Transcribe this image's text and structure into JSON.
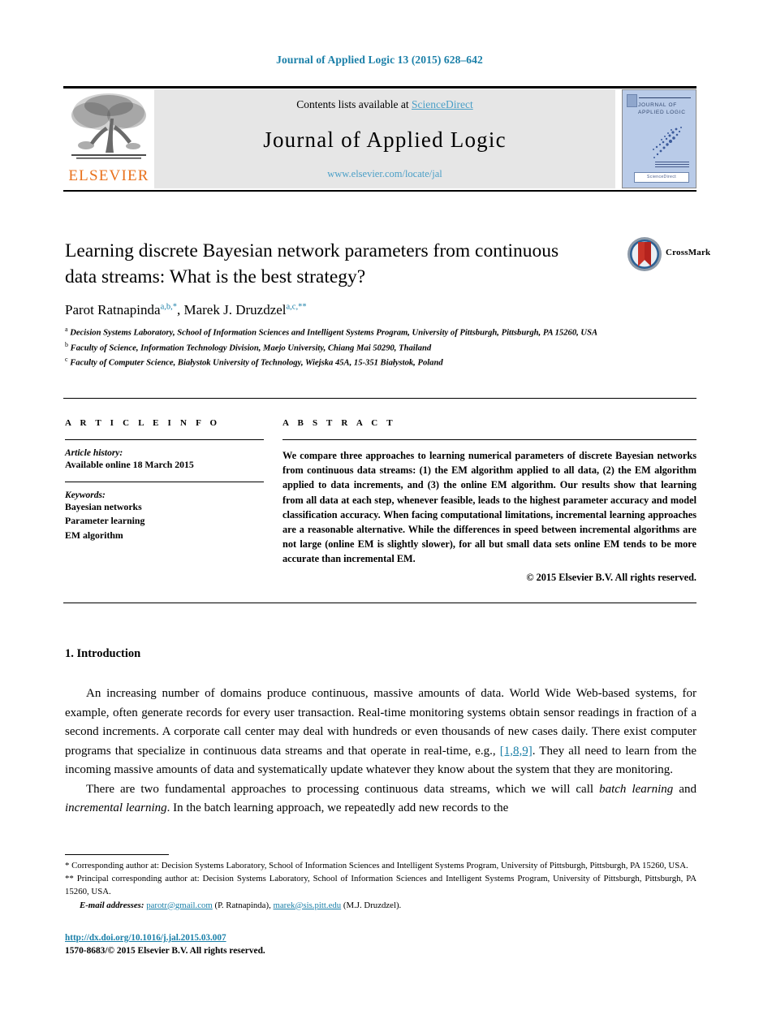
{
  "running_head": "Journal of Applied Logic 13 (2015) 628–642",
  "masthead": {
    "publisher_name": "ELSEVIER",
    "contents_prefix": "Contents lists available at ",
    "contents_link": "ScienceDirect",
    "journal_title": "Journal of Applied Logic",
    "journal_home_url": "www.elsevier.com/locate/jal",
    "cover_title": "JOURNAL OF APPLIED LOGIC",
    "cover_footer": "ScienceDirect"
  },
  "article": {
    "title": "Learning discrete Bayesian network parameters from continuous data streams: What is the best strategy?",
    "crossmark_label": "CrossMark",
    "authors_html": "Parot Ratnapinda<sup>a,b,*</sup>, Marek J. Druzdzel<sup>a,c,**</sup>",
    "affiliations": [
      {
        "mark": "a",
        "text": "Decision Systems Laboratory, School of Information Sciences and Intelligent Systems Program, University of Pittsburgh, Pittsburgh, PA 15260, USA"
      },
      {
        "mark": "b",
        "text": "Faculty of Science, Information Technology Division, Maejo University, Chiang Mai 50290, Thailand"
      },
      {
        "mark": "c",
        "text": "Faculty of Computer Science, Białystok University of Technology, Wiejska 45A, 15-351 Białystok, Poland"
      }
    ]
  },
  "article_info": {
    "heading": "A R T I C L E   I N F O",
    "history_label": "Article history:",
    "history_value": "Available online 18 March 2015",
    "keywords_label": "Keywords:",
    "keywords": [
      "Bayesian networks",
      "Parameter learning",
      "EM algorithm"
    ]
  },
  "abstract": {
    "heading": "A B S T R A C T",
    "body": "We compare three approaches to learning numerical parameters of discrete Bayesian networks from continuous data streams: (1) the EM algorithm applied to all data, (2) the EM algorithm applied to data increments, and (3) the online EM algorithm. Our results show that learning from all data at each step, whenever feasible, leads to the highest parameter accuracy and model classification accuracy. When facing computational limitations, incremental learning approaches are a reasonable alternative. While the differences in speed between incremental algorithms are not large (online EM is slightly slower), for all but small data sets online EM tends to be more accurate than incremental EM.",
    "copyright": "© 2015 Elsevier B.V. All rights reserved."
  },
  "body": {
    "section_number_title": "1.  Introduction",
    "paragraph_1_a": "An increasing number of domains produce continuous, massive amounts of data. World Wide Web-based systems, for example, often generate records for every user transaction. Real-time monitoring systems obtain sensor readings in fraction of a second increments. A corporate call center may deal with hundreds or even thousands of new cases daily. There exist computer programs that specialize in continuous data streams and that operate in real-time, e.g., ",
    "paragraph_1_citation": "[1,8,9]",
    "paragraph_1_b": ". They all need to learn from the incoming massive amounts of data and systematically update whatever they know about the system that they are monitoring.",
    "paragraph_2_a": "There are two fundamental approaches to processing continuous data streams, which we will call ",
    "paragraph_2_em1": "batch learning",
    "paragraph_2_b": " and ",
    "paragraph_2_em2": "incremental learning",
    "paragraph_2_c": ". In the batch learning approach, we repeatedly add new records to the"
  },
  "footnotes": {
    "note_star": "*  Corresponding author at: Decision Systems Laboratory, School of Information Sciences and Intelligent Systems Program, University of Pittsburgh, Pittsburgh, PA 15260, USA.",
    "note_doublestar": "**  Principal corresponding author at: Decision Systems Laboratory, School of Information Sciences and Intelligent Systems Program, University of Pittsburgh, Pittsburgh, PA 15260, USA.",
    "email_label": "E-mail addresses:",
    "email_1": "parotr@gmail.com",
    "email_1_owner": "(P. Ratnapinda),",
    "email_2": "marek@sis.pitt.edu",
    "email_2_owner": "(M.J. Druzdzel)."
  },
  "doi_block": {
    "doi_url": "http://dx.doi.org/10.1016/j.jal.2015.03.007",
    "issn_line": "1570-8683/© 2015 Elsevier B.V. All rights reserved."
  },
  "colors": {
    "link_blue": "#1a7fa8",
    "sciencedirect_blue": "#4a9fc7",
    "elsevier_orange": "#E9711C",
    "band_grey": "#e6e6e6",
    "cover_blue": "#b9cbe8"
  }
}
